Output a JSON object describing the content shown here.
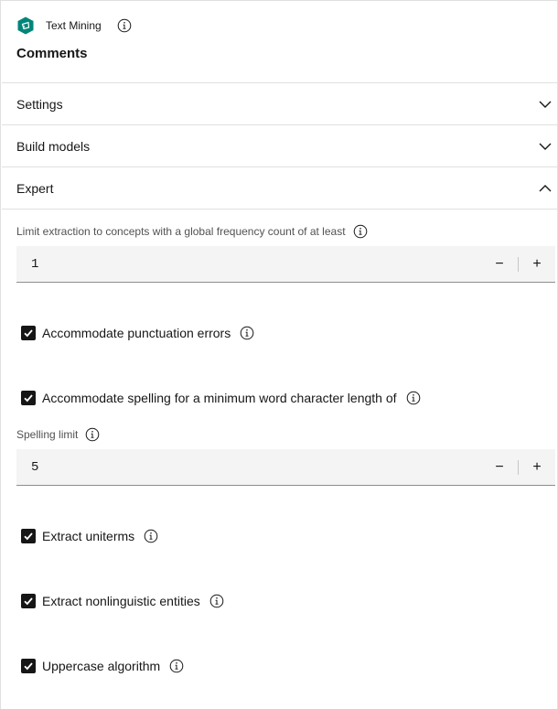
{
  "header": {
    "node_type": "Text Mining",
    "title": "Comments",
    "accent_color": "#00857a"
  },
  "accordion": {
    "settings_label": "Settings",
    "build_models_label": "Build models",
    "expert_label": "Expert"
  },
  "expert": {
    "global_freq_label": "Limit extraction to concepts with a global frequency count of at least",
    "global_freq_value": "1",
    "punctuation_label": "Accommodate punctuation errors",
    "punctuation_checked": true,
    "spelling_label": "Accommodate spelling for a minimum word character length of",
    "spelling_checked": true,
    "spelling_limit_label": "Spelling limit",
    "spelling_limit_value": "5",
    "uniterms_label": "Extract uniterms",
    "uniterms_checked": true,
    "nonlinguistic_label": "Extract nonlinguistic entities",
    "nonlinguistic_checked": true,
    "uppercase_label": "Uppercase algorithm",
    "uppercase_checked": true
  },
  "stepper": {
    "decrement_glyph": "−",
    "increment_glyph": "+"
  }
}
